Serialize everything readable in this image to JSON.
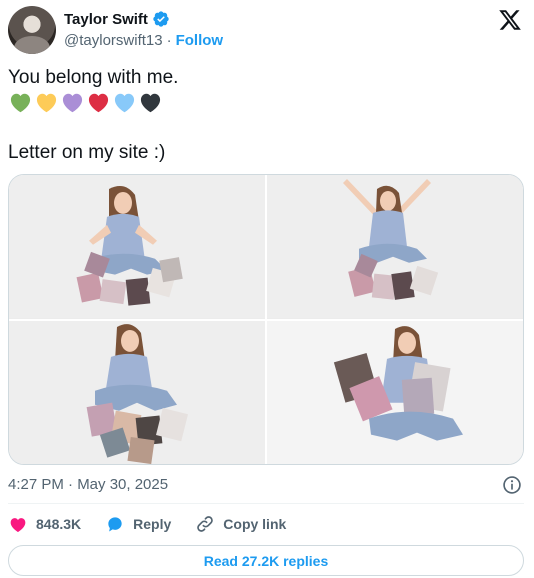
{
  "user": {
    "name": "Taylor Swift",
    "handle": "@taylorswift13",
    "separator": "·",
    "follow_label": "Follow"
  },
  "tweet": {
    "line1": "You belong with me.",
    "hearts": [
      {
        "icon": "green-heart-icon",
        "color": "#78b159"
      },
      {
        "icon": "yellow-heart-icon",
        "color": "#fdcb58"
      },
      {
        "icon": "purple-heart-icon",
        "color": "#aa8ed6"
      },
      {
        "icon": "red-heart-icon",
        "color": "#dd2e44"
      },
      {
        "icon": "light-blue-heart-icon",
        "color": "#88c9f9"
      },
      {
        "icon": "black-heart-icon",
        "color": "#31373d"
      }
    ],
    "line2": "Letter on my site :)"
  },
  "media": {
    "count": 4
  },
  "timestamp": "4:27 PM · May 30, 2025",
  "actions": {
    "likes": "848.3K",
    "reply_label": "Reply",
    "copy_link_label": "Copy link"
  },
  "replies_button": "Read 27.2K replies",
  "colors": {
    "accent": "#1d9bf0",
    "like": "#f91880",
    "muted": "#536471",
    "text": "#0f1419"
  }
}
